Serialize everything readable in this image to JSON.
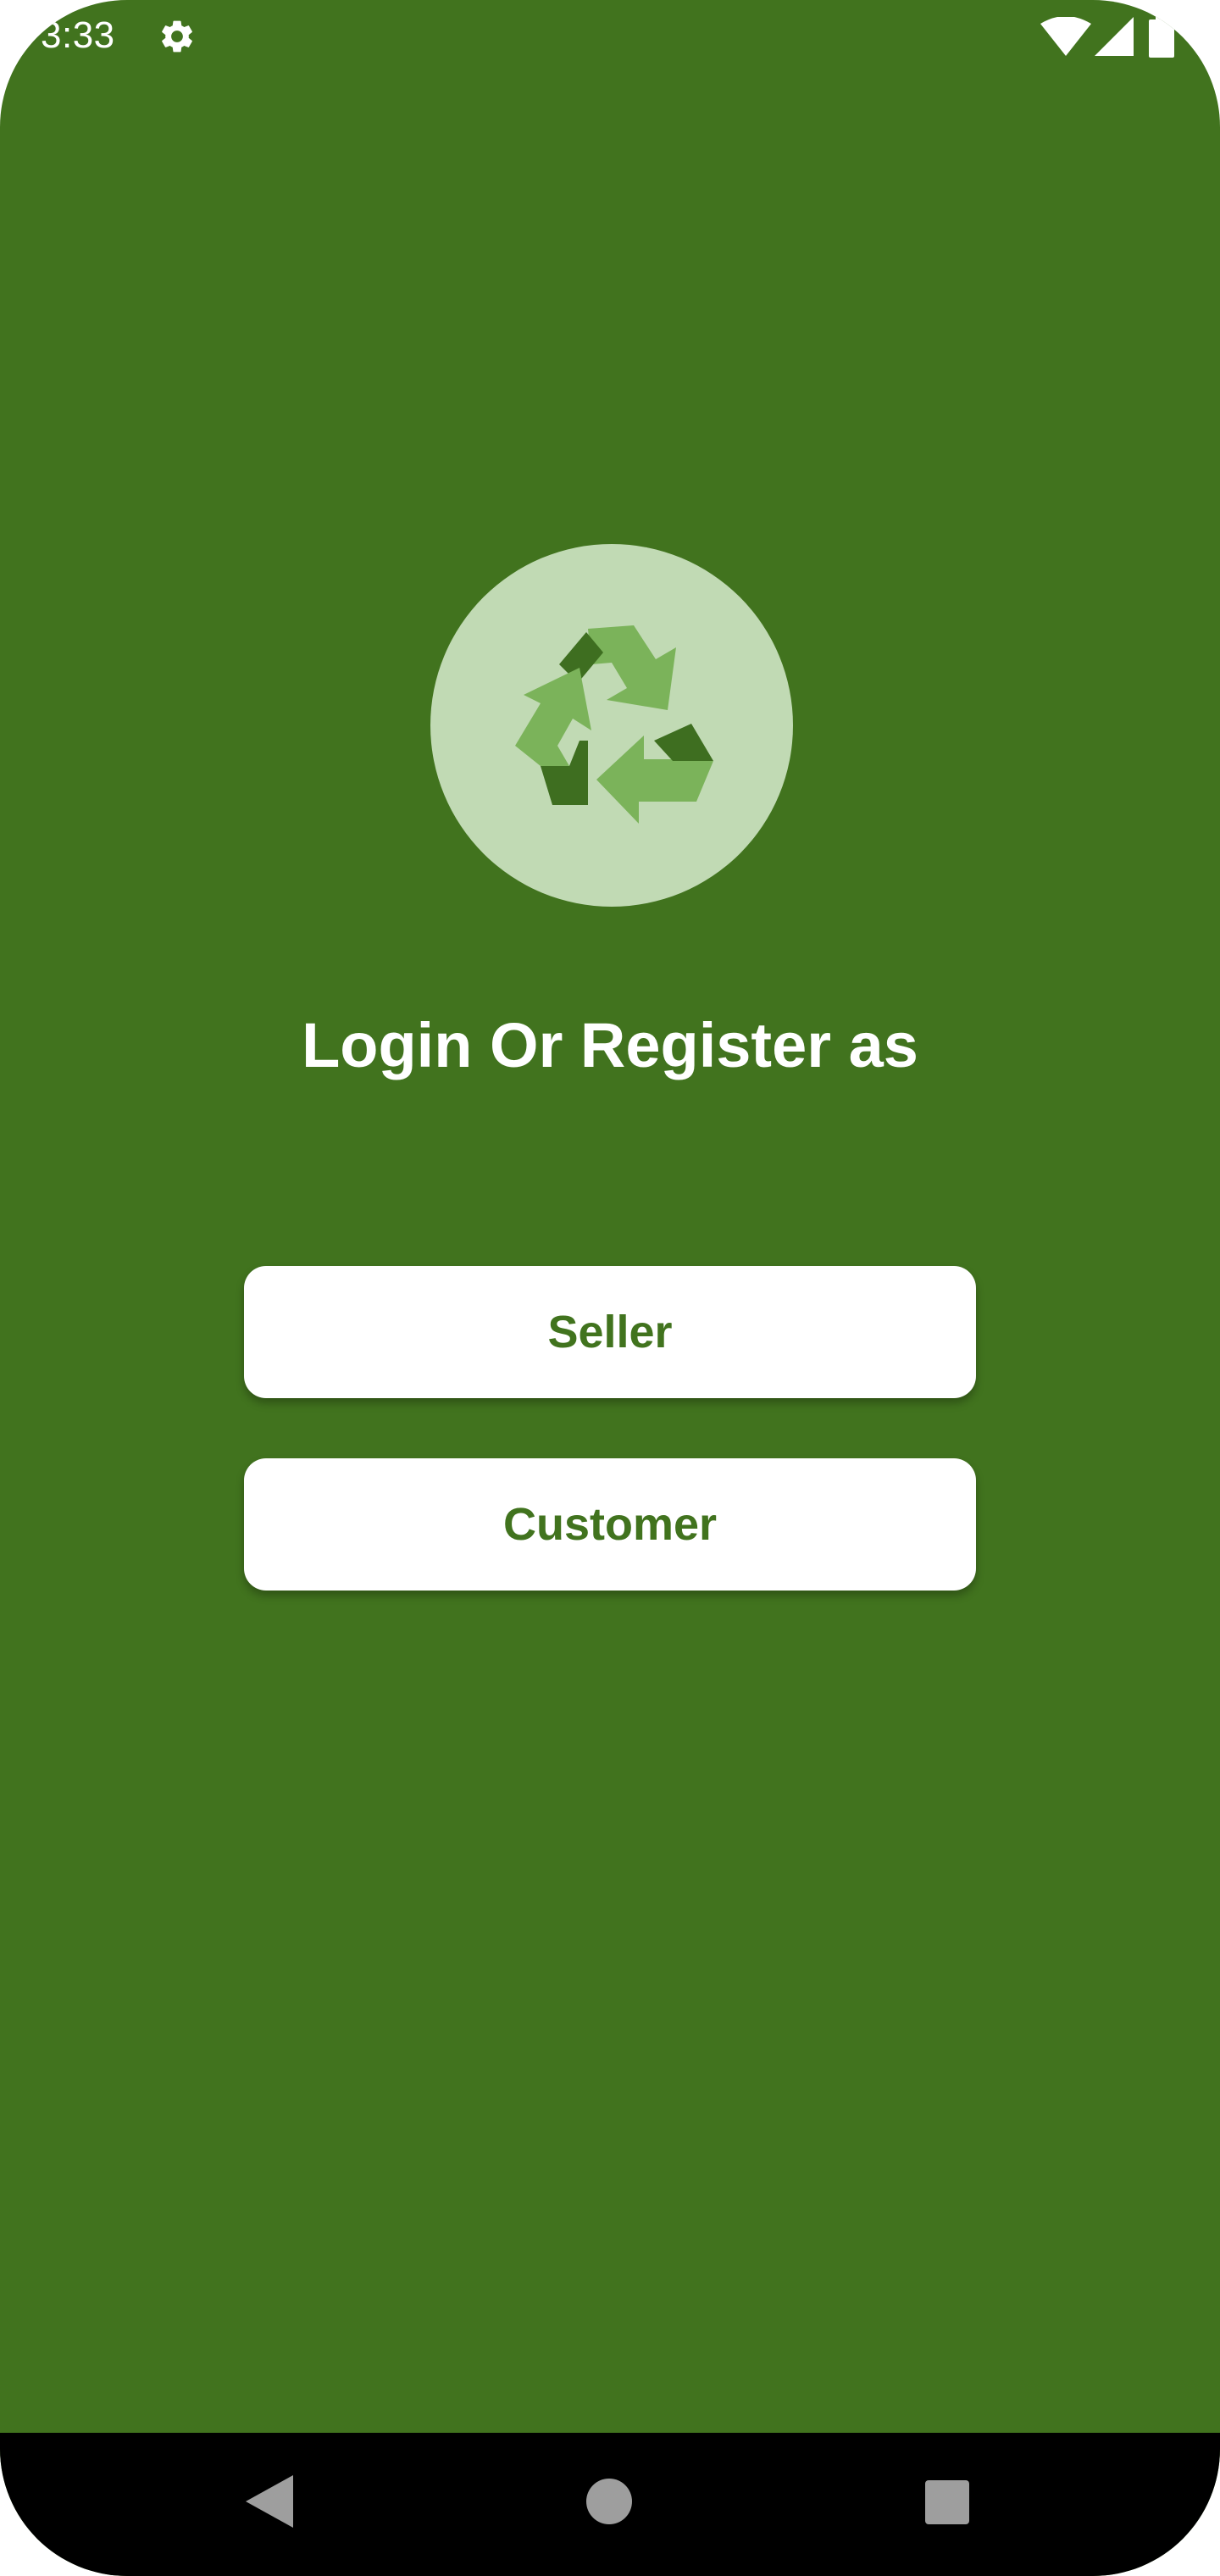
{
  "status_bar": {
    "time": "3:33",
    "icons": [
      "gear-icon",
      "wifi-icon",
      "signal-icon",
      "battery-icon"
    ]
  },
  "logo": {
    "icon": "recycle-icon",
    "colors": {
      "circle": "#c1dab4",
      "arrow_light": "#7bb35a",
      "arrow_dark": "#3e6e20"
    }
  },
  "main": {
    "title": "Login Or Register as",
    "buttons": {
      "seller": "Seller",
      "customer": "Customer"
    }
  },
  "nav_bar": {
    "icons": [
      "back-icon",
      "home-icon",
      "recents-icon"
    ]
  },
  "colors": {
    "background": "#41731e",
    "button_bg": "#ffffff",
    "button_text": "#41731e",
    "nav_bg": "#000000",
    "nav_icon": "#9e9e9e"
  }
}
